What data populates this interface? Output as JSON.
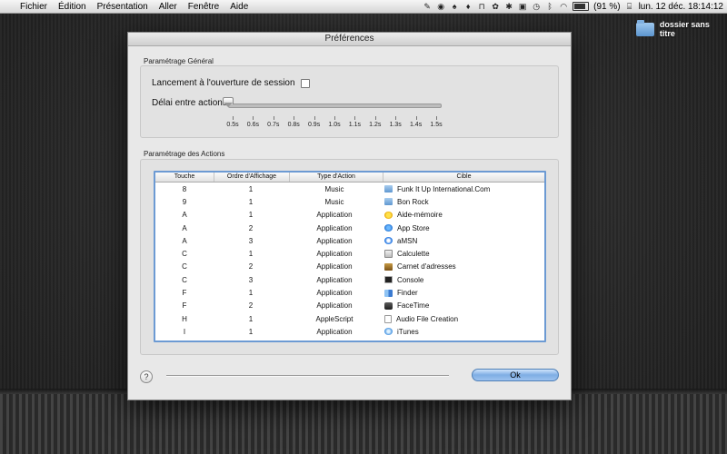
{
  "menubar": {
    "apple": "",
    "items": [
      "Fichier",
      "Édition",
      "Présentation",
      "Aller",
      "Fenêtre",
      "Aide"
    ],
    "battery": "(91 %)",
    "datetime": "lun. 12 déc.  18:14:12"
  },
  "desktop": {
    "folder_label": "dossier sans titre"
  },
  "window": {
    "title": "Préférences",
    "general": {
      "label": "Paramétrage Général",
      "login_label": "Lancement à l'ouverture de session",
      "login_checked": false,
      "delay_label": "Délai entre actions",
      "delay_value": "0.5s",
      "ticks": [
        "0.5s",
        "0.6s",
        "0.7s",
        "0.8s",
        "0.9s",
        "1.0s",
        "1.1s",
        "1.2s",
        "1.3s",
        "1.4s",
        "1.5s"
      ]
    },
    "actions": {
      "label": "Paramétrage des Actions",
      "columns": [
        "Touche",
        "Ordre d'Affichage",
        "Type d'Action",
        "Cible"
      ],
      "rows": [
        {
          "key": "8",
          "order": "1",
          "type": "Music",
          "target": "Funk It Up International.Com",
          "icon": "folder-icon"
        },
        {
          "key": "9",
          "order": "1",
          "type": "Music",
          "target": "Bon Rock",
          "icon": "folder-icon"
        },
        {
          "key": "A",
          "order": "1",
          "type": "Application",
          "target": "Aide-mémoire",
          "icon": "stickies-icon"
        },
        {
          "key": "A",
          "order": "2",
          "type": "Application",
          "target": "App Store",
          "icon": "app-store-icon"
        },
        {
          "key": "A",
          "order": "3",
          "type": "Application",
          "target": "aMSN",
          "icon": "amsn-icon"
        },
        {
          "key": "C",
          "order": "1",
          "type": "Application",
          "target": "Calculette",
          "icon": "calculator-icon"
        },
        {
          "key": "C",
          "order": "2",
          "type": "Application",
          "target": "Carnet d'adresses",
          "icon": "address-book-icon"
        },
        {
          "key": "C",
          "order": "3",
          "type": "Application",
          "target": "Console",
          "icon": "console-icon"
        },
        {
          "key": "F",
          "order": "1",
          "type": "Application",
          "target": "Finder",
          "icon": "finder-icon"
        },
        {
          "key": "F",
          "order": "2",
          "type": "Application",
          "target": "FaceTime",
          "icon": "facetime-icon"
        },
        {
          "key": "H",
          "order": "1",
          "type": "AppleScript",
          "target": "Audio File Creation",
          "icon": "script-document-icon"
        },
        {
          "key": "I",
          "order": "1",
          "type": "Application",
          "target": "iTunes",
          "icon": "itunes-icon"
        }
      ]
    },
    "help_label": "?",
    "ok_label": "Ok"
  },
  "colors": {
    "accent": "#6c9ad3",
    "ok_button": "#7eaee4"
  }
}
